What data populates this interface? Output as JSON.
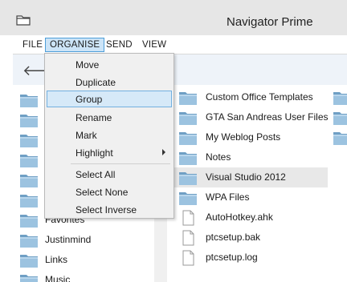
{
  "window": {
    "title": "Navigator Prime",
    "icon": "folder-icon"
  },
  "menubar": {
    "items": [
      {
        "label": "FILE"
      },
      {
        "label": "ORGANISE"
      },
      {
        "label": "SEND"
      },
      {
        "label": "VIEW"
      }
    ],
    "active": "ORGANISE"
  },
  "nav": {
    "back_icon": "arrow-left-icon",
    "back_glyph": "🡐"
  },
  "organise_menu": {
    "items": [
      {
        "label": "Move"
      },
      {
        "label": "Duplicate"
      },
      {
        "label": "Group"
      },
      {
        "label": "Rename"
      },
      {
        "label": "Mark"
      },
      {
        "label": "Highlight",
        "has_submenu": true
      },
      {
        "label": "Select All"
      },
      {
        "label": "Select None"
      },
      {
        "label": "Select Inverse"
      }
    ],
    "highlighted": "Group"
  },
  "left_pane": {
    "items": [
      {
        "label": "Favorites",
        "icon": "folder-icon"
      },
      {
        "label": "Justinmind",
        "icon": "folder-icon"
      },
      {
        "label": "Links",
        "icon": "folder-icon"
      },
      {
        "label": "Music",
        "icon": "folder-icon"
      }
    ]
  },
  "middle_pane": {
    "items": [
      {
        "label": "Custom Office Templates",
        "icon": "folder-icon"
      },
      {
        "label": "GTA San Andreas User Files",
        "icon": "folder-icon"
      },
      {
        "label": "My Weblog Posts",
        "icon": "folder-icon"
      },
      {
        "label": "Notes",
        "icon": "folder-icon"
      },
      {
        "label": "Visual Studio 2012",
        "icon": "folder-icon",
        "selected": true
      },
      {
        "label": "WPA Files",
        "icon": "folder-icon"
      },
      {
        "label": "AutoHotkey.ahk",
        "icon": "file-icon"
      },
      {
        "label": "ptcsetup.bak",
        "icon": "file-icon"
      },
      {
        "label": "ptcsetup.log",
        "icon": "file-icon"
      }
    ]
  },
  "colors": {
    "titlebar": "#e6e6e6",
    "menu_active_bg": "#cce4f7",
    "menu_active_border": "#4d9ed8",
    "folder": "#8fb8d8",
    "selection": "#e8e8e8"
  }
}
